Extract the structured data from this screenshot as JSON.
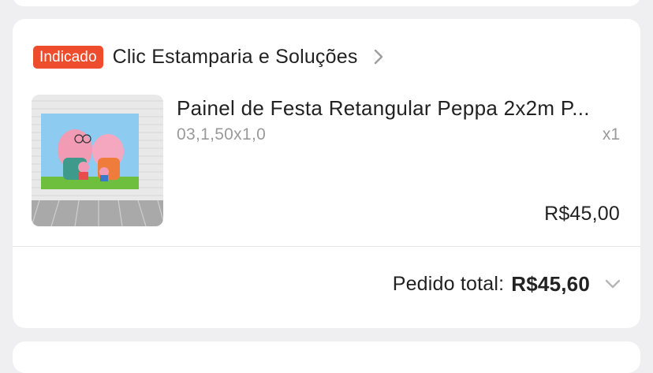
{
  "order": {
    "badge": "Indicado",
    "shop_name": "Clic Estamparia e Soluções",
    "item": {
      "title": "Painel de Festa Retangular Peppa 2x2m P...",
      "variant": "03,1,50x1,0",
      "quantity": "x1",
      "price": "R$45,00",
      "image_icon": "product-thumbnail"
    },
    "total_label": "Pedido total:",
    "total_value": "R$45,60"
  },
  "colors": {
    "badge": "#ee4d2d",
    "background": "#efeff1",
    "card": "#ffffff"
  }
}
